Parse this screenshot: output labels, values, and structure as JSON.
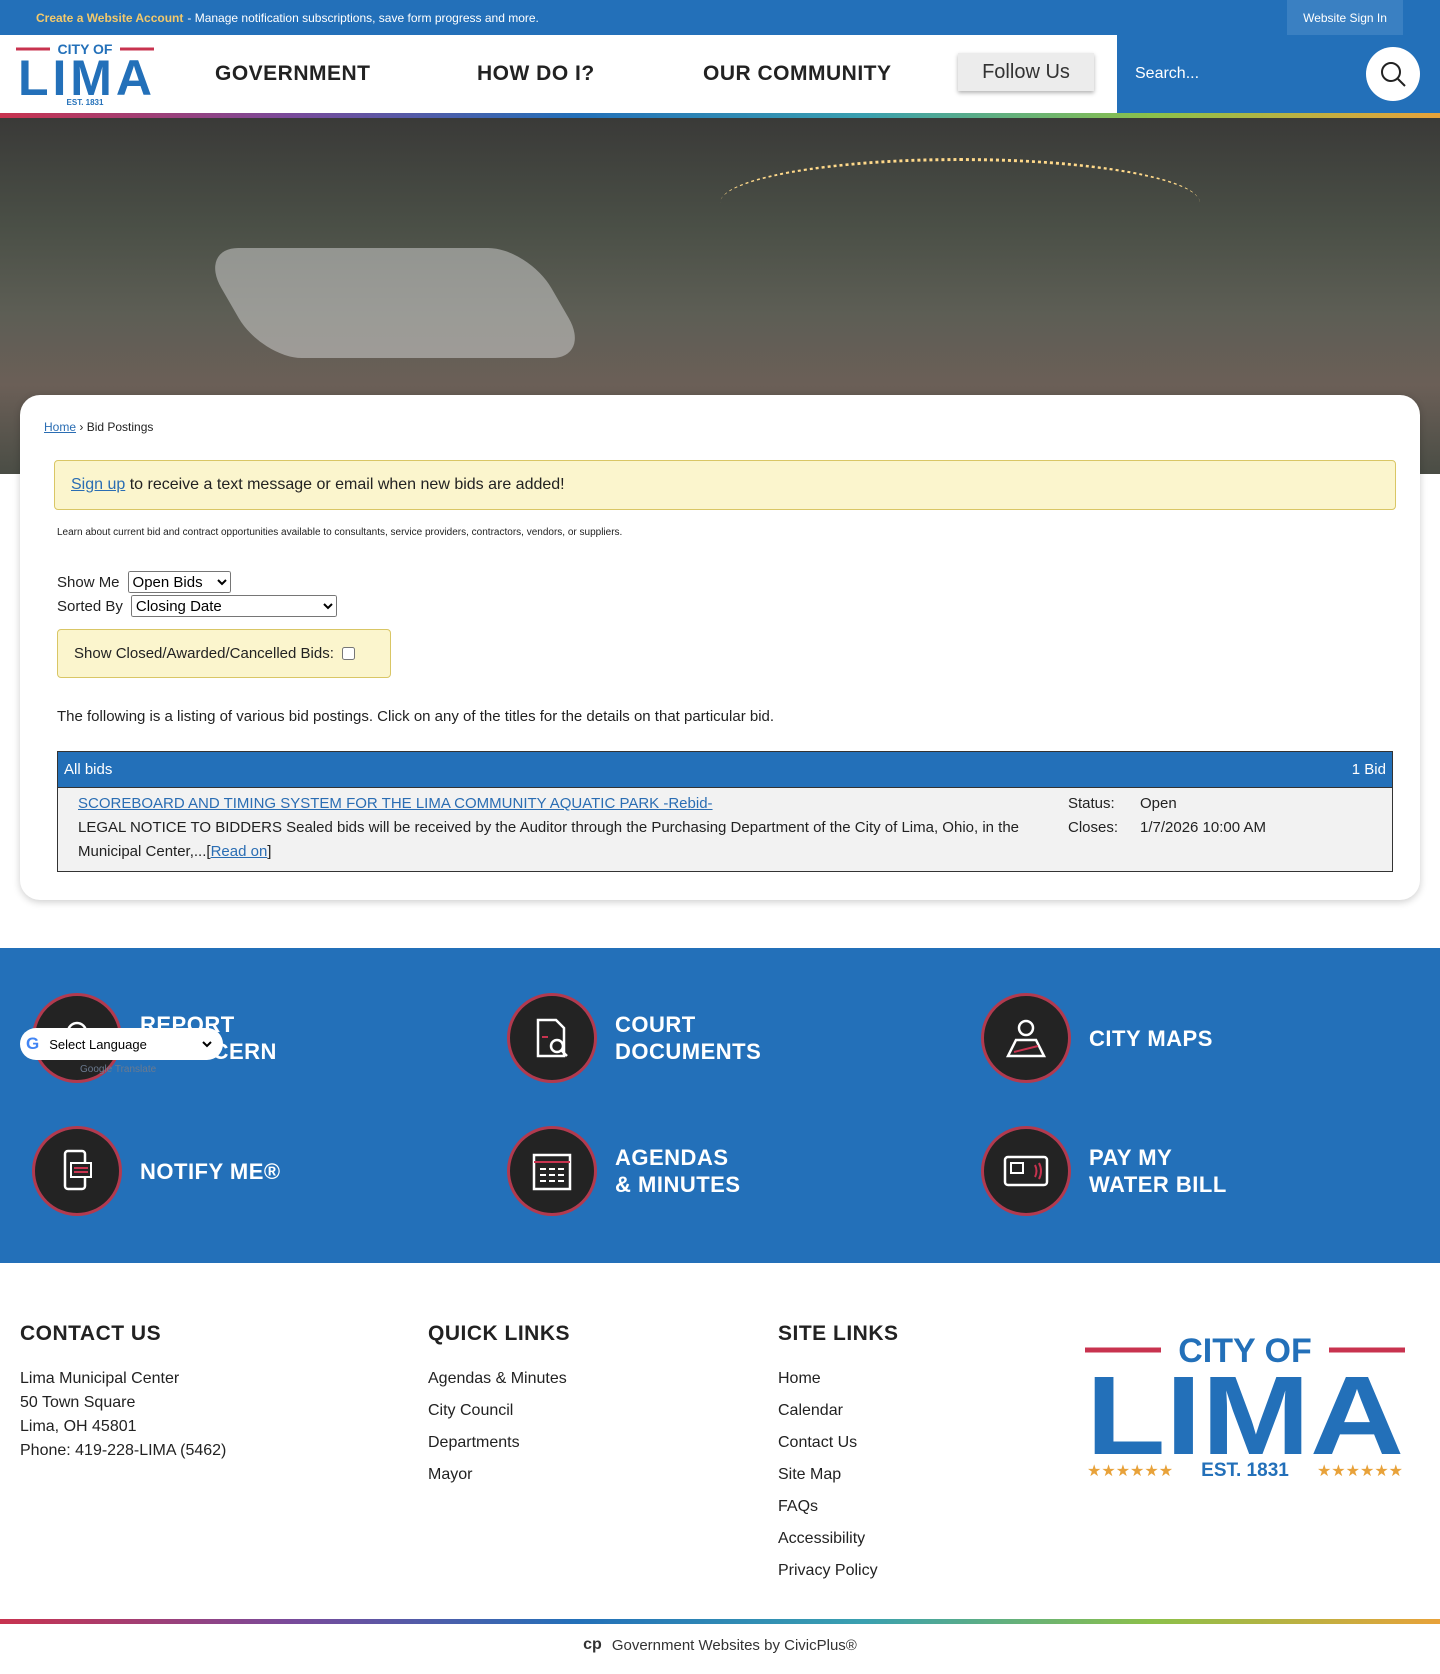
{
  "topbar": {
    "account_link": "Create a Website Account",
    "account_text": "- Manage notification subscriptions, save form progress and more.",
    "sign_in": "Website Sign In"
  },
  "logo": {
    "line1": "CITY OF",
    "line2": "LIMA",
    "line3": "EST. 1831"
  },
  "nav": {
    "items": [
      "GOVERNMENT",
      "HOW DO I?",
      "OUR COMMUNITY"
    ],
    "follow": "Follow Us"
  },
  "search": {
    "placeholder": "Search..."
  },
  "breadcrumb": {
    "home": "Home",
    "current": "Bid Postings"
  },
  "alert": {
    "link": "Sign up",
    "text": " to receive a text message or email when new bids are added!"
  },
  "intro": "Learn about current bid and contract opportunities available to consultants, service providers, contractors, vendors, or suppliers.",
  "filters": {
    "show_me_label": "Show Me",
    "show_me_value": "Open Bids",
    "sorted_by_label": "Sorted By",
    "sorted_by_value": "Closing Date",
    "closed_label": "Show Closed/Awarded/Cancelled Bids:"
  },
  "listing_text": "The following is a listing of various bid postings. Click on any of the titles for the details on that particular bid.",
  "bids": {
    "header": "All bids",
    "count": "1 Bid",
    "items": [
      {
        "title": "SCOREBOARD AND TIMING SYSTEM FOR THE LIMA COMMUNITY AQUATIC PARK -Rebid-",
        "desc": "LEGAL NOTICE TO BIDDERS Sealed bids will be received by the Auditor through the Purchasing Department of the City of Lima, Ohio, in the Municipal Center,...",
        "read_on": "Read on",
        "status_label": "Status:",
        "status": "Open",
        "closes_label": "Closes:",
        "closes": "1/7/2026 10:00 AM"
      }
    ]
  },
  "quicktiles": [
    {
      "l1": "REPORT",
      "l2": "A CONCERN"
    },
    {
      "l1": "COURT",
      "l2": "DOCUMENTS"
    },
    {
      "l1": "CITY MAPS",
      "l2": ""
    },
    {
      "l1": "NOTIFY ME®",
      "l2": ""
    },
    {
      "l1": "AGENDAS",
      "l2": "& MINUTES"
    },
    {
      "l1": "PAY MY",
      "l2": "WATER BILL"
    }
  ],
  "translate": {
    "select": "Select Language",
    "powered": "Google Translate"
  },
  "footer": {
    "contact": {
      "title": "CONTACT US",
      "lines": [
        "Lima Municipal Center",
        "50 Town Square",
        "Lima, OH 45801",
        "Phone: 419-228-LIMA (5462)"
      ]
    },
    "quick": {
      "title": "QUICK LINKS",
      "links": [
        "Agendas & Minutes",
        "City Council",
        "Departments",
        "Mayor"
      ]
    },
    "site": {
      "title": "SITE LINKS",
      "links": [
        "Home",
        "Calendar",
        "Contact Us",
        "Site Map",
        "FAQs",
        "Accessibility",
        "Privacy Policy"
      ]
    }
  },
  "civicplus": "Government Websites by CivicPlus®"
}
